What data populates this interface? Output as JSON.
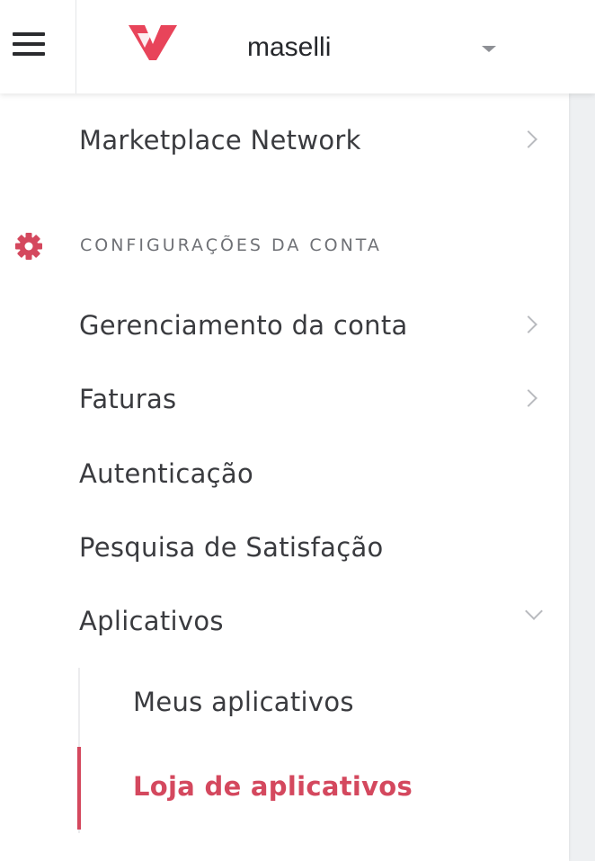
{
  "header": {
    "account_name": "maselli",
    "menu_icon": "hamburger-menu-icon",
    "logo_icon": "brand-logo-icon",
    "dropdown_icon": "caret-down-icon",
    "brand_color": "#e8445a"
  },
  "sidebar": {
    "top_items": [
      {
        "label": "Marketplace Network",
        "chevron": "chevron-right-icon"
      }
    ],
    "section": {
      "title": "CONFIGURAÇÕES DA CONTA",
      "icon": "gear-icon"
    },
    "items": [
      {
        "label": "Gerenciamento da conta",
        "chevron": "chevron-right-icon"
      },
      {
        "label": "Faturas",
        "chevron": "chevron-right-icon"
      },
      {
        "label": "Autenticação"
      },
      {
        "label": "Pesquisa de Satisfação"
      },
      {
        "label": "Aplicativos",
        "chevron": "chevron-down-icon",
        "expanded": true
      }
    ],
    "sub_items": [
      {
        "label": "Meus aplicativos",
        "active": false
      },
      {
        "label": "Loja de aplicativos",
        "active": true
      }
    ],
    "active_color": "#d4485e"
  }
}
